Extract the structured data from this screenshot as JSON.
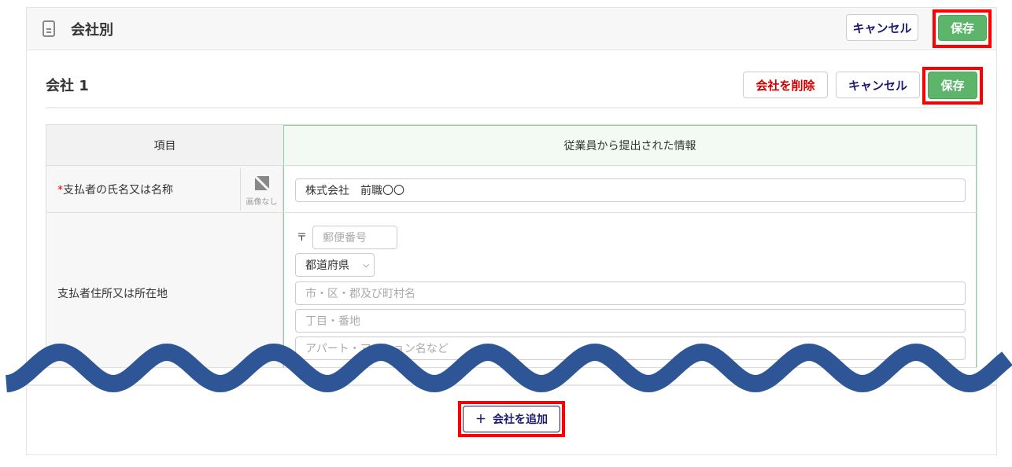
{
  "header": {
    "title": "会社別",
    "cancel_label": "キャンセル",
    "save_label": "保存"
  },
  "company": {
    "title": "会社 1",
    "delete_label": "会社を削除",
    "cancel_label": "キャンセル",
    "save_label": "保存"
  },
  "table": {
    "col_item": "項目",
    "col_info": "従業員から提出された情報",
    "rows": [
      {
        "label": "支払者の氏名又は名称",
        "required": "*",
        "no_image": "画像なし",
        "value": "株式会社　前職〇〇"
      },
      {
        "label": "支払者住所又は所在地",
        "postal_mark": "〒",
        "postal_placeholder": "郵便番号",
        "prefecture": "都道府県",
        "city_placeholder": "市・区・郡及び町村名",
        "street_placeholder": "丁目・番地",
        "building_placeholder": "アパート・マンション名など"
      }
    ]
  },
  "add_company": {
    "icon": "plus-icon",
    "label": "会社を追加"
  },
  "colors": {
    "save": "#5cb56a",
    "highlight": "#ff0000",
    "wave": "#2e5596",
    "navy": "#1a1a6e"
  }
}
